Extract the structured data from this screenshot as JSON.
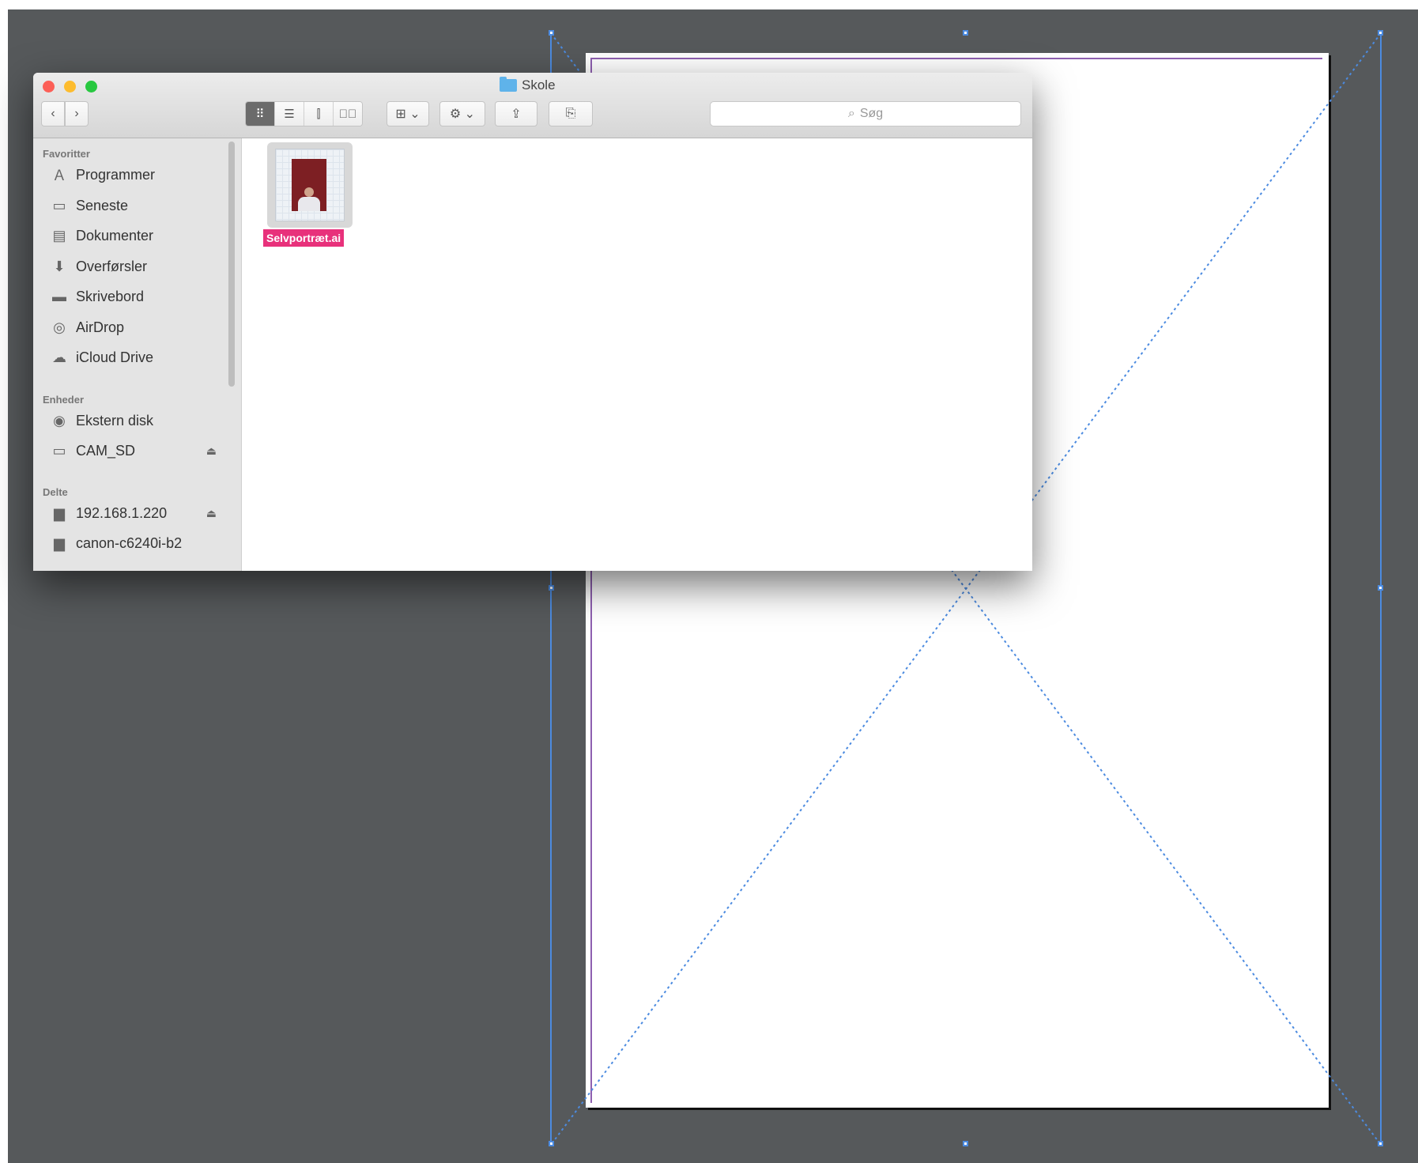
{
  "window": {
    "title": "Skole",
    "nav": {
      "back": "‹",
      "forward": "›"
    },
    "view_buttons": [
      "⠿",
      "☰",
      "⫿",
      "⊤⃓"
    ],
    "arrange_label": "⊞ ⌄",
    "action_label": "⚙ ⌄",
    "share_label": "⇪",
    "tag_label": "⎘",
    "search": {
      "placeholder": "Søg",
      "icon": "search-icon"
    }
  },
  "sidebar": {
    "sections": [
      {
        "title": "Favoritter",
        "items": [
          {
            "label": "Programmer",
            "icon": "applications-icon"
          },
          {
            "label": "Seneste",
            "icon": "recents-icon"
          },
          {
            "label": "Dokumenter",
            "icon": "documents-icon"
          },
          {
            "label": "Overførsler",
            "icon": "downloads-icon"
          },
          {
            "label": "Skrivebord",
            "icon": "desktop-icon"
          },
          {
            "label": "AirDrop",
            "icon": "airdrop-icon"
          },
          {
            "label": "iCloud Drive",
            "icon": "icloud-icon"
          }
        ]
      },
      {
        "title": "Enheder",
        "items": [
          {
            "label": "Ekstern disk",
            "icon": "disk-icon"
          },
          {
            "label": "CAM_SD",
            "icon": "drive-icon",
            "eject": "⏏"
          }
        ]
      },
      {
        "title": "Delte",
        "items": [
          {
            "label": "192.168.1.220",
            "icon": "server-icon",
            "eject": "⏏"
          },
          {
            "label": "canon-c6240i-b2",
            "icon": "server-icon"
          }
        ]
      }
    ]
  },
  "files": [
    {
      "name": "Selvportræt.ai",
      "selected": true
    }
  ],
  "colors": {
    "canvas": "#56595b",
    "selection": "#e8317b",
    "guide": "#4c8be0",
    "margin": "#8e5fb0"
  }
}
